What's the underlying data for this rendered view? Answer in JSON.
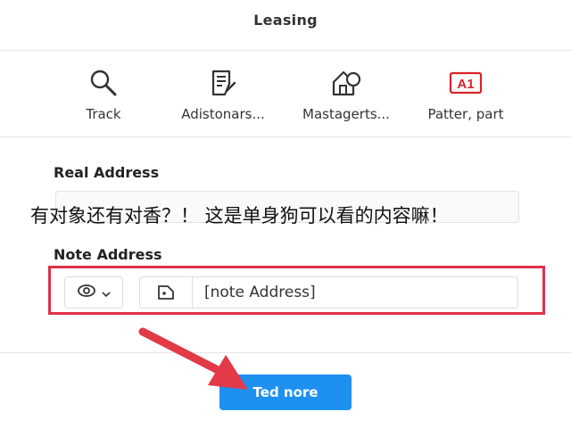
{
  "header": {
    "title": "Leasing"
  },
  "toolbar": {
    "items": [
      {
        "label": "Track",
        "icon": "search-icon"
      },
      {
        "label": "Adistonars...",
        "icon": "document-edit-icon"
      },
      {
        "label": "Mastagerts...",
        "icon": "house-icon"
      },
      {
        "label": "Patter, part",
        "icon": "a1-badge-icon",
        "badge_text": "A1"
      }
    ]
  },
  "form": {
    "real_address": {
      "label": "Real Address",
      "value": ""
    },
    "note_address": {
      "label": "Note Address",
      "value": "[note Address]"
    }
  },
  "overlay_caption": "有对象还有对香？！ 这是单身狗可以看的内容嘛！",
  "primary_button": {
    "label": "Ted nore"
  },
  "colors": {
    "accent": "#1e90f0",
    "highlight": "#e0314a",
    "badge": "#d9232d"
  }
}
